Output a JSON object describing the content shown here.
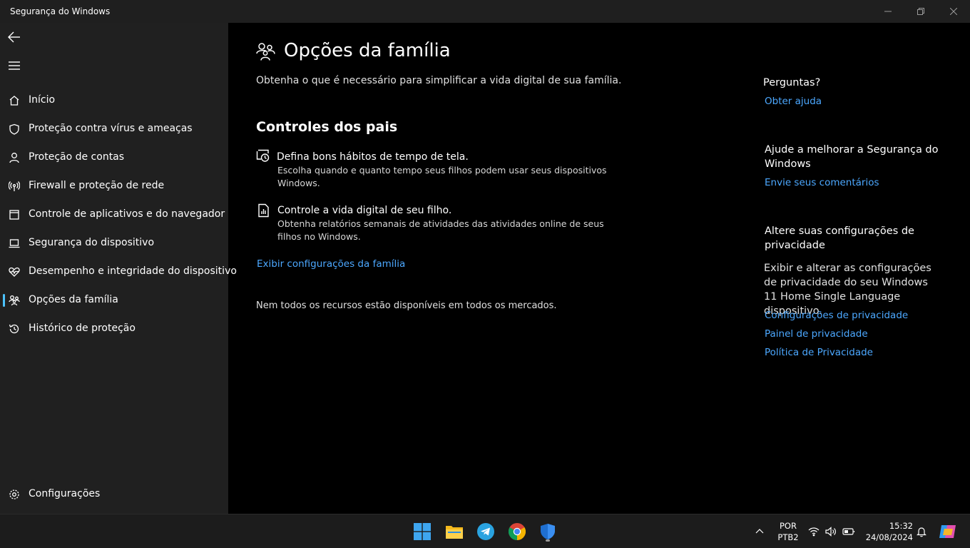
{
  "window": {
    "title": "Segurança do Windows"
  },
  "sidebar": {
    "back_icon": "back-arrow-icon",
    "menu_icon": "hamburger-icon",
    "items": [
      {
        "label": "Início",
        "icon": "home-icon"
      },
      {
        "label": "Proteção contra vírus e ameaças",
        "icon": "shield-icon"
      },
      {
        "label": "Proteção de contas",
        "icon": "person-icon"
      },
      {
        "label": "Firewall e proteção de rede",
        "icon": "antenna-icon"
      },
      {
        "label": "Controle de aplicativos e do navegador",
        "icon": "app-window-icon"
      },
      {
        "label": "Segurança do dispositivo",
        "icon": "laptop-icon"
      },
      {
        "label": "Desempenho e integridade do dispositivo",
        "icon": "heart-pulse-icon"
      },
      {
        "label": "Opções da família",
        "icon": "family-icon",
        "selected": true
      },
      {
        "label": "Histórico de proteção",
        "icon": "history-icon"
      }
    ],
    "settings_label": "Configurações",
    "accent_color": "#4cc2ff"
  },
  "main": {
    "title": "Opções da família",
    "subtitle": "Obtenha o que é necessário para simplificar a vida digital de sua família.",
    "section_title": "Controles dos pais",
    "features": [
      {
        "title": "Defina bons hábitos de tempo de tela.",
        "description": "Escolha quando e quanto tempo seus filhos podem usar seus dispositivos Windows.",
        "icon": "screen-time-icon"
      },
      {
        "title": "Controle a vida digital de seu filho.",
        "description": "Obtenha relatórios semanais de atividades das atividades online de seus filhos no Windows.",
        "icon": "report-icon"
      }
    ],
    "family_link": "Exibir configurações da família",
    "note": "Nem todos os recursos estão disponíveis em todos os mercados."
  },
  "right_panel": {
    "questions_title": "Perguntas?",
    "help_link": "Obter ajuda",
    "improve_title": "Ajude a melhorar a Segurança do Windows",
    "feedback_link": "Envie seus comentários",
    "privacy_title": "Altere suas configurações de privacidade",
    "privacy_text": "Exibir e alterar as configurações de privacidade do seu Windows 11 Home Single Language dispositivo.",
    "privacy_links": [
      "Configurações de privacidade",
      "Painel de privacidade",
      "Política de Privacidade"
    ],
    "link_color": "#4ca8ff"
  },
  "taskbar": {
    "apps": [
      "windows-start-icon",
      "file-explorer-icon",
      "telegram-icon",
      "chrome-icon",
      "windows-security-icon"
    ],
    "language_line1": "POR",
    "language_line2": "PTB2",
    "time": "15:32",
    "date": "24/08/2024"
  }
}
